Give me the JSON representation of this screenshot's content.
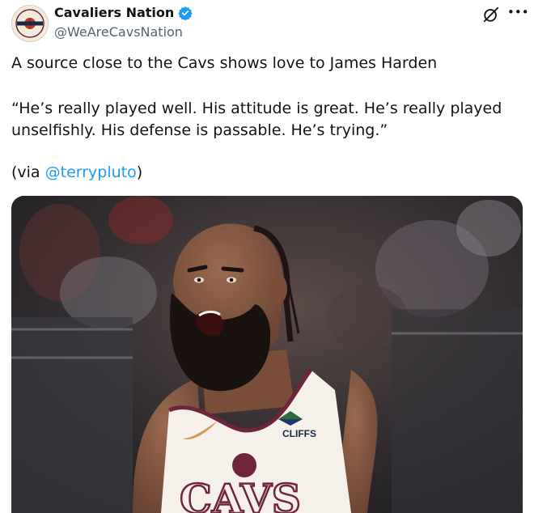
{
  "author": {
    "name": "Cavaliers Nation",
    "handle": "@WeAreCavsNation",
    "avatar_text_top": "CAVALIERS",
    "avatar_text_bottom": "NATION",
    "verified": true
  },
  "tweet": {
    "line1": "A source close to the Cavs shows love to James Harden",
    "quote": "“He’s really played well. His attitude is great. He’s really played unselfishly. His defense is passable. He’s trying.”",
    "via_prefix": "(via ",
    "mention": "@terrypluto",
    "via_suffix": ")"
  },
  "media": {
    "jersey_sponsor": "CLIFFS",
    "jersey_text": "CAVS"
  },
  "icons": {
    "grok": "grok-icon",
    "more": "more-options-icon"
  },
  "colors": {
    "link": "#1d9bf0",
    "verified": "#1d9bf0",
    "jersey_wine": "#6f263d",
    "jersey_white": "#f5f1ea"
  }
}
